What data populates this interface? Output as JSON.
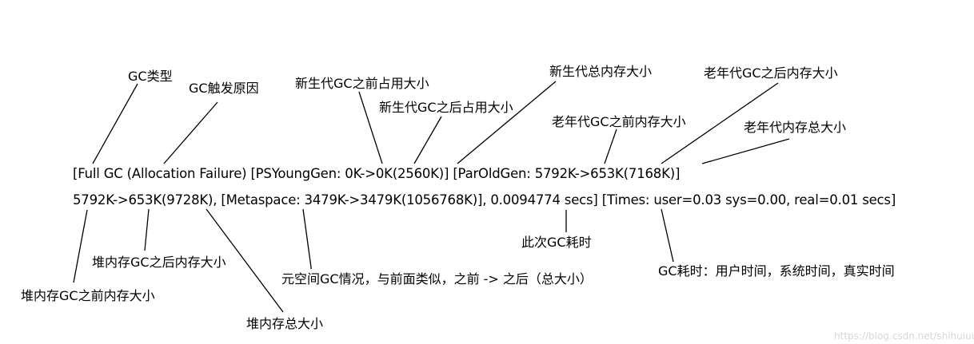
{
  "log": {
    "line1": "[Full GC (Allocation Failure) [PSYoungGen: 0K->0K(2560K)] [ParOldGen: 5792K->653K(7168K)]",
    "line2": "5792K->653K(9728K),  [Metaspace: 3479K->3479K(1056768K)], 0.0094774 secs] [Times: user=0.03 sys=0.00, real=0.01 secs]"
  },
  "labels": {
    "gc_type": "GC类型",
    "gc_cause": "GC触发原因",
    "young_before": "新生代GC之前占用大小",
    "young_after": "新生代GC之后占用大小",
    "young_total": "新生代总内存大小",
    "old_before": "老年代GC之前内存大小",
    "old_after": "老年代GC之后内存大小",
    "old_total": "老年代内存总大小",
    "heap_after": "堆内存GC之后内存大小",
    "heap_before": "堆内存GC之前内存大小",
    "heap_total": "堆内存总大小",
    "metaspace": "元空间GC情况，与前面类似，之前 -> 之后（总大小）",
    "gc_time": "此次GC耗时",
    "gc_times": "GC耗时：用户时间，系统时间，真实时间"
  },
  "watermark": "https://blog.csdn.net/shihuiuu33"
}
